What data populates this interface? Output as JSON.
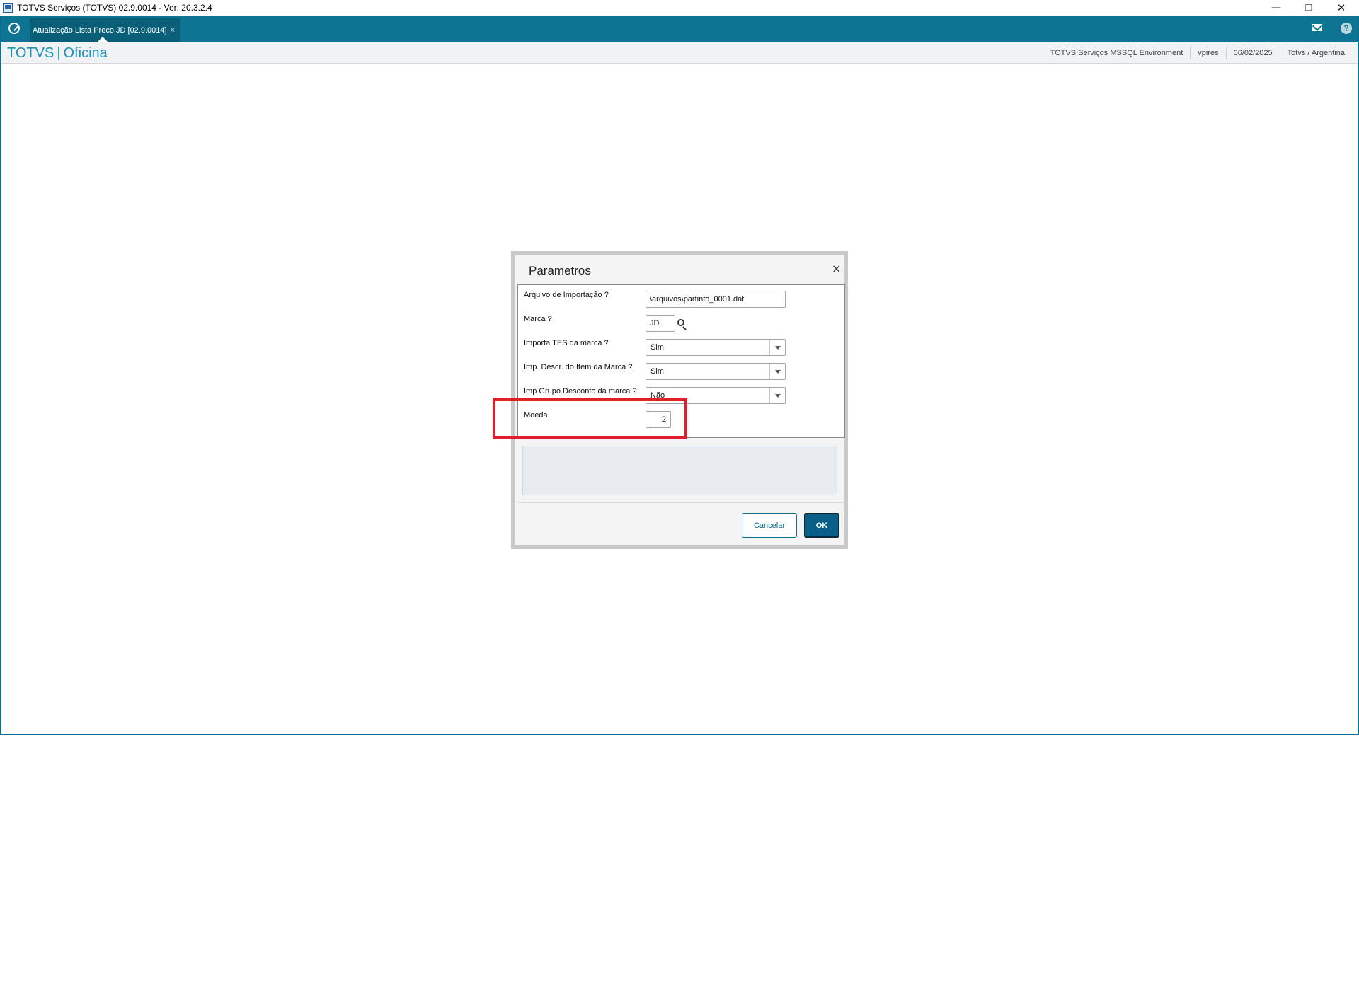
{
  "window": {
    "title": "TOTVS Serviços (TOTVS) 02.9.0014 - Ver: 20.3.2.4",
    "min_icon": "minimize-icon",
    "restore_icon": "restore-icon",
    "close_icon": "close-icon",
    "min_glyph": "—",
    "restore_glyph": "❐",
    "close_glyph": "✕"
  },
  "tabs": {
    "active_label": "Atualização Lista Preco JD [02.9.0014]",
    "close_glyph": "×"
  },
  "header": {
    "brand_left": "TOTVS",
    "brand_sep": "|",
    "brand_right": "Oficina",
    "environment": "TOTVS Serviços MSSQL Environment",
    "user": "vpires",
    "date": "06/02/2025",
    "company": "Totvs / Argentina"
  },
  "dialog": {
    "title": "Parametros",
    "close_glyph": "×",
    "fields": {
      "arquivo_label": "Arquivo de Importação ?",
      "arquivo_value": "\\arquivos\\partinfo_0001.dat",
      "marca_label": "Marca ?",
      "marca_value": "JD",
      "importa_tes_label": "Importa TES da marca ?",
      "importa_tes_value": "Sim",
      "imp_descr_label": "Imp. Descr. do Item da Marca ?",
      "imp_descr_value": "Sim",
      "imp_grupo_label": "Imp Grupo Desconto da marca ?",
      "imp_grupo_value": "Não",
      "moeda_label": "Moeda",
      "moeda_value": "2"
    },
    "cancel_label": "Cancelar",
    "ok_label": "OK"
  },
  "colors": {
    "tabbar": "#0d7593",
    "brand": "#1a93b8",
    "ok_button": "#0a5f89",
    "highlight": "#e01f2a"
  }
}
